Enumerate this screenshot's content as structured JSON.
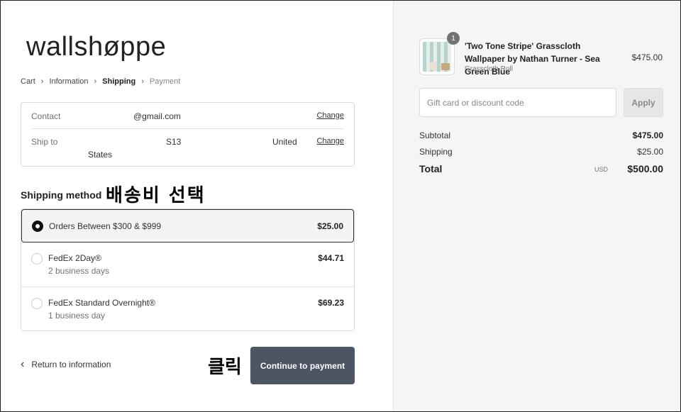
{
  "brand": {
    "logo_text": "wallshøppe"
  },
  "breadcrumb": {
    "items": [
      {
        "label": "Cart"
      },
      {
        "label": "Information"
      },
      {
        "label": "Shipping"
      },
      {
        "label": "Payment"
      }
    ]
  },
  "review": {
    "contact": {
      "label": "Contact",
      "value": "@gmail.com",
      "change": "Change"
    },
    "ship_to": {
      "label": "Ship to",
      "value_a": "S13",
      "value_b": "United",
      "value_c": "States",
      "change": "Change"
    }
  },
  "shipping": {
    "title": "Shipping method",
    "methods": [
      {
        "name": "Orders Between $300 & $999",
        "sub": "",
        "price": "$25.00",
        "selected": true
      },
      {
        "name": "FedEx 2Day®",
        "sub": "2 business days",
        "price": "$44.71",
        "selected": false
      },
      {
        "name": "FedEx Standard Overnight®",
        "sub": "1 business day",
        "price": "$69.23",
        "selected": false
      }
    ]
  },
  "annotations": {
    "select_shipping": "배송비 선택",
    "click": "클릭"
  },
  "footer": {
    "return_label": "Return to information",
    "continue_label": "Continue to payment"
  },
  "summary": {
    "product": {
      "title": "'Two Tone Stripe' Grasscloth Wallpaper by Nathan Turner - Sea Green Blue",
      "variant": "Grasscloth Roll",
      "price": "$475.00",
      "quantity": "1"
    },
    "discount": {
      "placeholder": "Gift card or discount code",
      "apply_label": "Apply"
    },
    "subtotal": {
      "label": "Subtotal",
      "value": "$475.00"
    },
    "shipping": {
      "label": "Shipping",
      "value": "$25.00"
    },
    "total": {
      "label": "Total",
      "currency": "USD",
      "value": "$500.00"
    }
  },
  "colors": {
    "primary_button": "#4b5563",
    "sidebar_bg": "#f5f5f5",
    "border": "#d9d9d9"
  }
}
